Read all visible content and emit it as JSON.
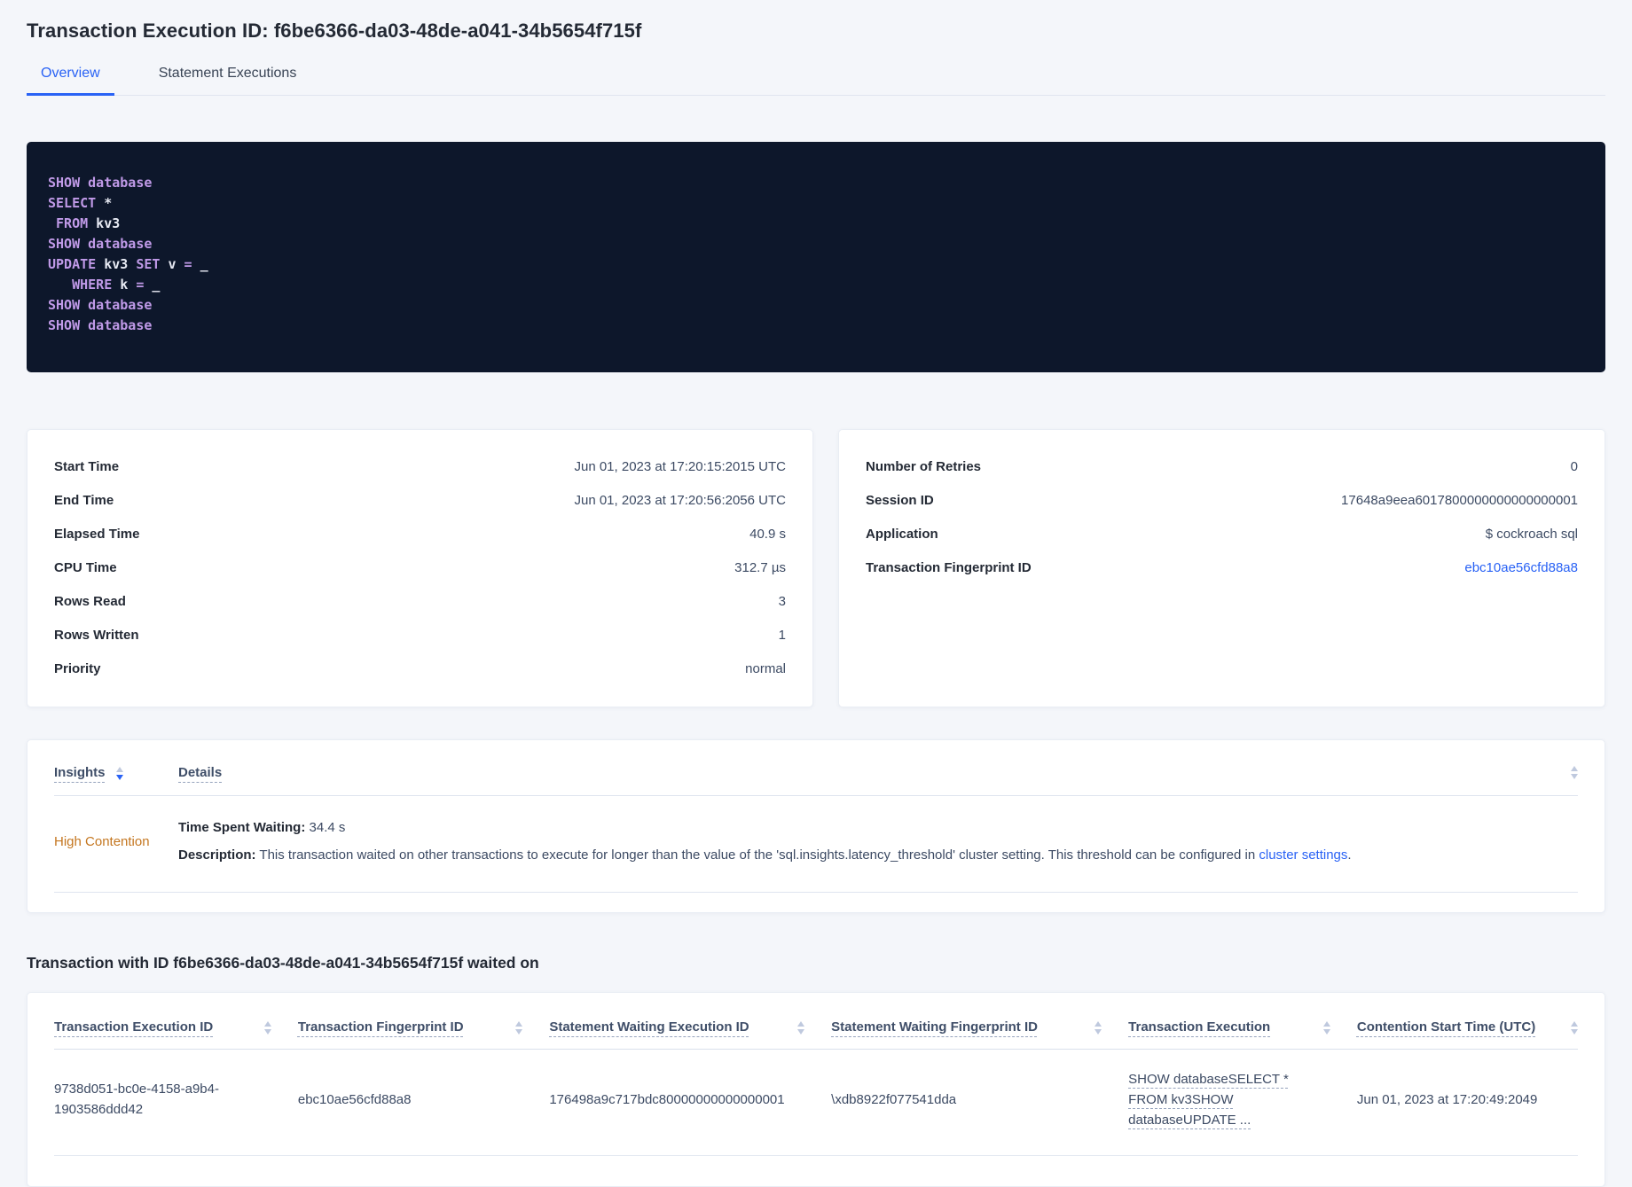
{
  "colors": {
    "accent_blue": "#2962f5",
    "insight_orange": "#c4761f",
    "code_background": "#0d172b",
    "code_keyword": "#c09ae8",
    "code_plain": "#e7eaf3"
  },
  "header": {
    "title": "Transaction Execution ID: f6be6366-da03-48de-a041-34b5654f715f",
    "tabs": [
      {
        "label": "Overview",
        "active": true
      },
      {
        "label": "Statement Executions",
        "active": false
      }
    ]
  },
  "sql": {
    "lines": [
      {
        "segs": [
          {
            "t": "SHOW database"
          }
        ]
      },
      {
        "segs": [
          {
            "t": "SELECT"
          },
          {
            "t": " *"
          }
        ]
      },
      {
        "segs": [
          {
            "t": " FROM"
          },
          {
            "t": " kv3"
          }
        ]
      },
      {
        "segs": [
          {
            "t": "SHOW database"
          }
        ]
      },
      {
        "segs": [
          {
            "t": "UPDATE"
          },
          {
            "t": " kv3 "
          },
          {
            "t": "SET"
          },
          {
            "t": " v "
          },
          {
            "t": "="
          },
          {
            "t": " _"
          }
        ]
      },
      {
        "segs": [
          {
            "t": "   WHERE"
          },
          {
            "t": " k "
          },
          {
            "t": "="
          },
          {
            "t": " _"
          }
        ]
      },
      {
        "segs": [
          {
            "t": "SHOW database"
          }
        ]
      },
      {
        "segs": [
          {
            "t": "SHOW database"
          }
        ]
      }
    ]
  },
  "details_left": {
    "rows": [
      {
        "label": "Start Time",
        "value": "Jun 01, 2023 at 17:20:15:2015 UTC"
      },
      {
        "label": "End Time",
        "value": "Jun 01, 2023 at 17:20:56:2056 UTC"
      },
      {
        "label": "Elapsed Time",
        "value": "40.9 s"
      },
      {
        "label": "CPU Time",
        "value": "312.7 µs"
      },
      {
        "label": "Rows Read",
        "value": "3"
      },
      {
        "label": "Rows Written",
        "value": "1"
      },
      {
        "label": "Priority",
        "value": "normal"
      }
    ]
  },
  "details_right": {
    "rows": [
      {
        "label": "Number of Retries",
        "value": "0"
      },
      {
        "label": "Session ID",
        "value": "17648a9eea6017800000000000000001"
      },
      {
        "label": "Application",
        "value": "$ cockroach sql"
      },
      {
        "label": "Transaction Fingerprint ID",
        "value": "ebc10ae56cfd88a8"
      }
    ]
  },
  "insights": {
    "header": {
      "insights_label": "Insights",
      "details_label": "Details"
    },
    "row": {
      "insight": "High Contention",
      "waiting_label": "Time Spent Waiting:",
      "waiting_value": " 34.4 s",
      "desc_label": "Description:",
      "desc_text": " This transaction waited on other transactions to execute for longer than the value of the 'sql.insights.latency_threshold' cluster setting. This threshold can be configured in ",
      "desc_link": "cluster settings",
      "desc_period": "."
    }
  },
  "waited_on": {
    "heading": "Transaction with ID f6be6366-da03-48de-a041-34b5654f715f waited on",
    "columns": [
      "Transaction Execution ID",
      "Transaction Fingerprint ID",
      "Statement Waiting Execution ID",
      "Statement Waiting Fingerprint ID",
      "Transaction Execution",
      "Contention Start Time (UTC)"
    ],
    "row": {
      "txn_execution_id": "9738d051-bc0e-4158-a9b4-1903586ddd42",
      "txn_fingerprint_id": "ebc10ae56cfd88a8",
      "stmt_waiting_execution_id": "176498a9c717bdc80000000000000001",
      "stmt_waiting_fingerprint_id": "\\xdb8922f077541dda",
      "txn_execution": "SHOW databaseSELECT * FROM kv3SHOW databaseUPDATE ...",
      "contention_start_time": "Jun 01, 2023 at 17:20:49:2049"
    }
  }
}
